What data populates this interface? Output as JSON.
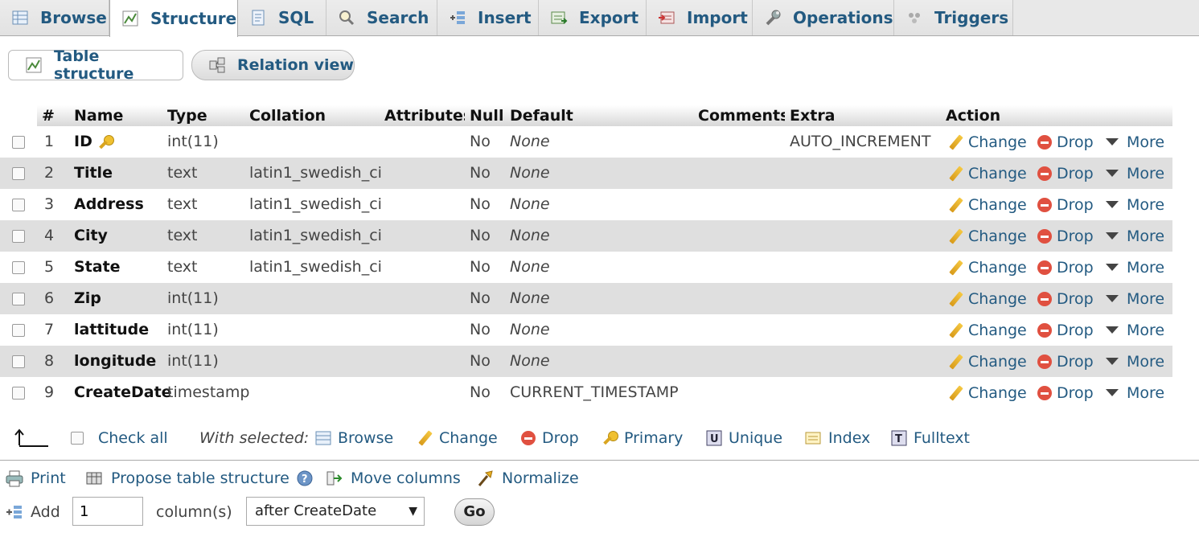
{
  "tabs": [
    {
      "label": "Browse",
      "icon": "browse-icon"
    },
    {
      "label": "Structure",
      "icon": "structure-icon"
    },
    {
      "label": "SQL",
      "icon": "sql-icon"
    },
    {
      "label": "Search",
      "icon": "search-icon"
    },
    {
      "label": "Insert",
      "icon": "insert-icon"
    },
    {
      "label": "Export",
      "icon": "export-icon"
    },
    {
      "label": "Import",
      "icon": "import-icon"
    },
    {
      "label": "Operations",
      "icon": "wrench-icon"
    },
    {
      "label": "Triggers",
      "icon": "triggers-icon"
    }
  ],
  "subtabs": {
    "table_structure": "Table structure",
    "relation_view": "Relation view"
  },
  "columns": {
    "num": "#",
    "name": "Name",
    "type": "Type",
    "collation": "Collation",
    "attributes": "Attributes",
    "null": "Null",
    "default": "Default",
    "comments": "Comments",
    "extra": "Extra",
    "action": "Action"
  },
  "rows": [
    {
      "num": "1",
      "name": "ID",
      "type": "int(11)",
      "collation": "",
      "null": "No",
      "default": "None",
      "extra": "AUTO_INCREMENT"
    },
    {
      "num": "2",
      "name": "Title",
      "type": "text",
      "collation": "latin1_swedish_ci",
      "null": "No",
      "default": "None",
      "extra": ""
    },
    {
      "num": "3",
      "name": "Address",
      "type": "text",
      "collation": "latin1_swedish_ci",
      "null": "No",
      "default": "None",
      "extra": ""
    },
    {
      "num": "4",
      "name": "City",
      "type": "text",
      "collation": "latin1_swedish_ci",
      "null": "No",
      "default": "None",
      "extra": ""
    },
    {
      "num": "5",
      "name": "State",
      "type": "text",
      "collation": "latin1_swedish_ci",
      "null": "No",
      "default": "None",
      "extra": ""
    },
    {
      "num": "6",
      "name": "Zip",
      "type": "int(11)",
      "collation": "",
      "null": "No",
      "default": "None",
      "extra": ""
    },
    {
      "num": "7",
      "name": "lattitude",
      "type": "int(11)",
      "collation": "",
      "null": "No",
      "default": "None",
      "extra": ""
    },
    {
      "num": "8",
      "name": "longitude",
      "type": "int(11)",
      "collation": "",
      "null": "No",
      "default": "None",
      "extra": ""
    },
    {
      "num": "9",
      "name": "CreateDate",
      "type": "timestamp",
      "collation": "",
      "null": "No",
      "default": "CURRENT_TIMESTAMP",
      "extra": ""
    }
  ],
  "actions": {
    "change": "Change",
    "drop": "Drop",
    "more": "More"
  },
  "with_selected": {
    "check_all": "Check all",
    "label": "With selected:",
    "browse": "Browse",
    "change": "Change",
    "drop": "Drop",
    "primary": "Primary",
    "unique": "Unique",
    "index": "Index",
    "fulltext": "Fulltext"
  },
  "tools": {
    "print": "Print",
    "propose": "Propose table structure",
    "move_columns": "Move columns",
    "normalize": "Normalize"
  },
  "add": {
    "label": "Add",
    "count": "1",
    "unit": "column(s)",
    "position": "after CreateDate",
    "go": "Go"
  },
  "colors": {
    "link": "#235a81",
    "even_row": "#dfdfdf",
    "drop_red": "#e05040"
  }
}
